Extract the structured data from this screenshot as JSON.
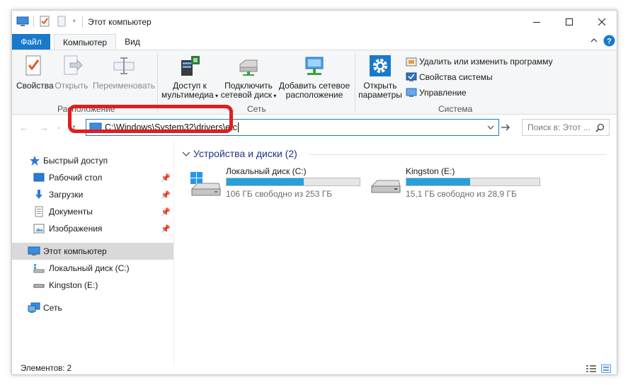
{
  "window": {
    "title": "Этот компьютер"
  },
  "tabs": {
    "file": "Файл",
    "computer": "Компьютер",
    "view": "Вид"
  },
  "ribbon": {
    "location": {
      "label": "Расположение",
      "properties": "Свойства",
      "open": "Открыть",
      "rename": "Переименовать"
    },
    "network": {
      "label": "Сеть",
      "media_line1": "Доступ к",
      "media_line2": "мультимедиа",
      "map_line1": "Подключить",
      "map_line2": "сетевой диск",
      "add_line1": "Добавить сетевое",
      "add_line2": "расположение"
    },
    "system": {
      "label": "Система",
      "settings_line1": "Открыть",
      "settings_line2": "параметры",
      "uninstall": "Удалить или изменить программу",
      "sysprops": "Свойства системы",
      "manage": "Управление"
    }
  },
  "address": {
    "path": "C:\\Windows\\System32\\drivers\\etc"
  },
  "search": {
    "placeholder": "Поиск в: Этот ..."
  },
  "navpane": {
    "quick_access": "Быстрый доступ",
    "desktop": "Рабочий стол",
    "downloads": "Загрузки",
    "documents": "Документы",
    "pictures": "Изображения",
    "this_pc": "Этот компьютер",
    "local_disk": "Локальный диск (C:)",
    "kingston": "Kingston (E:)",
    "network": "Сеть"
  },
  "content": {
    "group_header": "Устройства и диски (2)",
    "drives": [
      {
        "name": "Локальный диск (C:)",
        "free_text": "106 ГБ свободно из 253 ГБ",
        "used_fraction": 0.58
      },
      {
        "name": "Kingston (E:)",
        "free_text": "15,1 ГБ свободно из 28,9 ГБ",
        "used_fraction": 0.48
      }
    ]
  },
  "status": {
    "items": "Элементов: 2"
  },
  "colors": {
    "accent": "#1979ca",
    "highlight": "#e11d1d",
    "bar": "#26a0da",
    "group_header": "#1e3287"
  }
}
